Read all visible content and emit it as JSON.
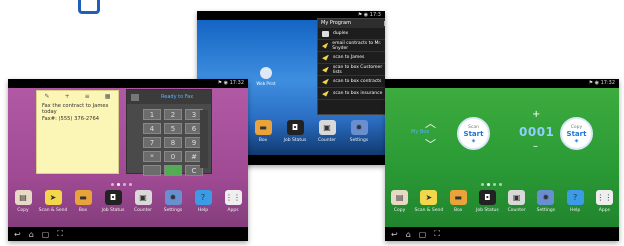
{
  "left_screen": {
    "status": "⚑ ◉ 17:32",
    "note_lines": [
      "Fax the contract to James",
      "today",
      "Fax#: (555) 376-2764"
    ],
    "note_toolbar": [
      "✎",
      "+",
      "≡",
      "▦"
    ],
    "keypad_title": "Ready to Fax",
    "keys": [
      "1",
      "2",
      "3",
      "4",
      "5",
      "6",
      "7",
      "8",
      "9",
      "*",
      "0",
      "#",
      "",
      "",
      "C"
    ],
    "dock": [
      {
        "label": "Copy",
        "icon": "copy-icon",
        "color": "#e7d9c6"
      },
      {
        "label": "Scan & Send",
        "icon": "send-icon",
        "color": "#f2d64c"
      },
      {
        "label": "Box",
        "icon": "box-icon",
        "color": "#e9a33a"
      },
      {
        "label": "Job Status",
        "icon": "job-status-icon",
        "color": "#222222"
      },
      {
        "label": "Counter",
        "icon": "counter-icon",
        "color": "#d9d9d9"
      },
      {
        "label": "Settings",
        "icon": "gear-icon",
        "color": "#6a8fd0"
      },
      {
        "label": "Help",
        "icon": "help-icon",
        "color": "#3b9be6"
      },
      {
        "label": "Apps",
        "icon": "apps-icon",
        "color": "#eeeeee"
      }
    ]
  },
  "middle_screen": {
    "status": "⚑ ◉ 17:3",
    "app_label": "Web Print",
    "popup_title": "My Program",
    "popup_items": [
      {
        "label": "duplex",
        "icon": "document-icon"
      },
      {
        "label": "email contracts to Mr. Snyder",
        "icon": "send-icon"
      },
      {
        "label": "scan to James",
        "icon": "send-icon"
      },
      {
        "label": "scan to box Customer lists",
        "icon": "send-icon"
      },
      {
        "label": "scan to box contracts",
        "icon": "send-icon"
      },
      {
        "label": "scan to box insurance",
        "icon": "send-icon"
      }
    ],
    "dock": [
      {
        "label": "Box",
        "icon": "box-icon",
        "color": "#e9a33a"
      },
      {
        "label": "Job Status",
        "icon": "job-status-icon",
        "color": "#222222"
      },
      {
        "label": "Counter",
        "icon": "counter-icon",
        "color": "#d9d9d9"
      },
      {
        "label": "Settings",
        "icon": "gear-icon",
        "color": "#6a8fd0"
      }
    ]
  },
  "right_screen": {
    "status": "⚑ ◉ 17:32",
    "box_label": "My Box",
    "scan_title": "Scan",
    "scan_start": "Start",
    "copy_title": "Copy",
    "copy_start": "Start",
    "copies": "0001",
    "dock": [
      {
        "label": "Copy",
        "icon": "copy-icon",
        "color": "#e7d9c6"
      },
      {
        "label": "Scan & Send",
        "icon": "send-icon",
        "color": "#f2d64c"
      },
      {
        "label": "Box",
        "icon": "box-icon",
        "color": "#e9a33a"
      },
      {
        "label": "Job Status",
        "icon": "job-status-icon",
        "color": "#222222"
      },
      {
        "label": "Counter",
        "icon": "counter-icon",
        "color": "#d9d9d9"
      },
      {
        "label": "Settings",
        "icon": "gear-icon",
        "color": "#6a8fd0"
      },
      {
        "label": "Help",
        "icon": "help-icon",
        "color": "#3b9be6"
      },
      {
        "label": "Apps",
        "icon": "apps-icon",
        "color": "#eeeeee"
      }
    ]
  },
  "nav_symbols": [
    "↩",
    "⌂",
    "▢",
    "⛶"
  ]
}
